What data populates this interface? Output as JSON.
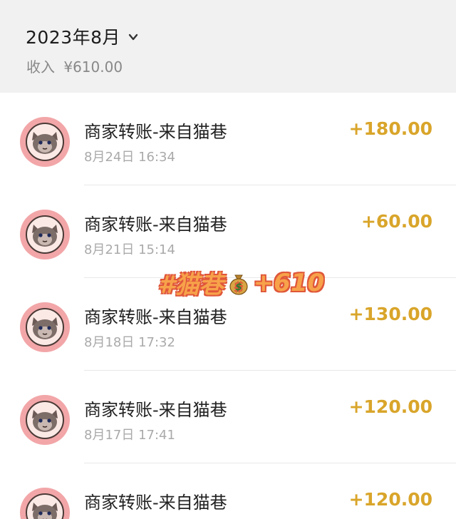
{
  "header": {
    "month": "2023年8月",
    "income_label": "收入",
    "income_total": "¥610.00"
  },
  "transactions": [
    {
      "title": "商家转账-来自猫巷",
      "time": "8月24日 16:34",
      "amount": "+180.00"
    },
    {
      "title": "商家转账-来自猫巷",
      "time": "8月21日 15:14",
      "amount": "+60.00"
    },
    {
      "title": "商家转账-来自猫巷",
      "time": "8月18日 17:32",
      "amount": "+130.00"
    },
    {
      "title": "商家转账-来自猫巷",
      "time": "8月17日 17:41",
      "amount": "+120.00"
    },
    {
      "title": "商家转账-来自猫巷",
      "time": "",
      "amount": "+120.00"
    }
  ],
  "overlay": {
    "tag": "#猫巷",
    "icon": "money-bag-icon",
    "total": "+610"
  },
  "colors": {
    "header_bg": "#f1f1f1",
    "amount": "#d9a52a",
    "avatar_bg": "#f2a6a8",
    "overlay_fill": "#f7a24a",
    "overlay_stroke": "#e0573a"
  }
}
